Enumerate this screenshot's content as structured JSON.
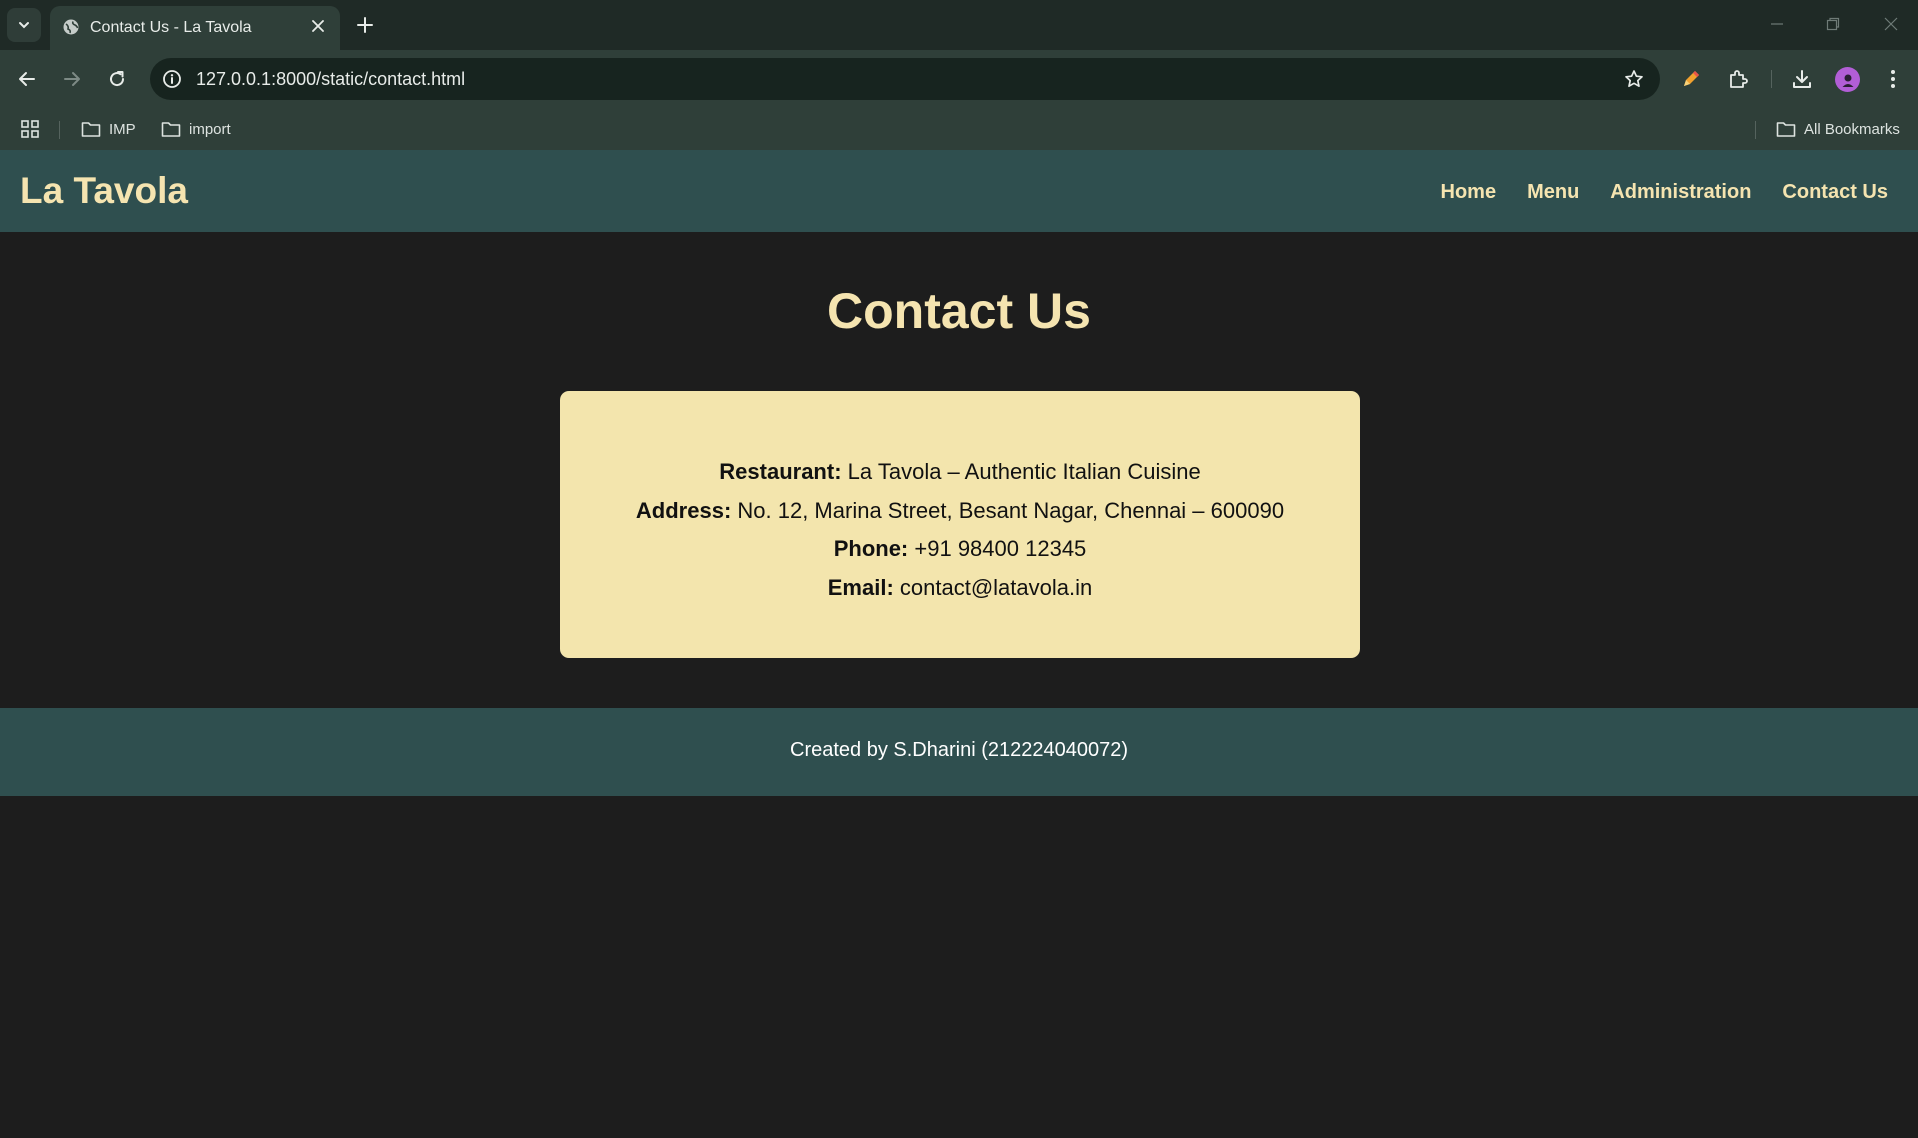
{
  "browser": {
    "tab_title": "Contact Us - La Tavola",
    "url": "127.0.0.1:8000/static/contact.html",
    "bookmarks": [
      {
        "label": "IMP"
      },
      {
        "label": "import"
      }
    ],
    "all_bookmarks_label": "All Bookmarks"
  },
  "site": {
    "brand": "La Tavola",
    "nav": [
      {
        "label": "Home"
      },
      {
        "label": "Menu"
      },
      {
        "label": "Administration"
      },
      {
        "label": "Contact Us"
      }
    ]
  },
  "page": {
    "heading": "Contact Us",
    "contact": {
      "restaurant_label": "Restaurant:",
      "restaurant_value": "La Tavola – Authentic Italian Cuisine",
      "address_label": "Address:",
      "address_value": "No. 12, Marina Street, Besant Nagar, Chennai – 600090",
      "phone_label": "Phone:",
      "phone_value": "+91 98400 12345",
      "email_label": "Email:",
      "email_value": "contact@latavola.in"
    }
  },
  "footer": {
    "text": "Created by S.Dharini (212224040072)"
  },
  "colors": {
    "page_bg": "#1d1d1d",
    "header_bg": "#2f4f4f",
    "accent_text": "#f5e4b0",
    "card_bg": "#f3e5ad"
  }
}
